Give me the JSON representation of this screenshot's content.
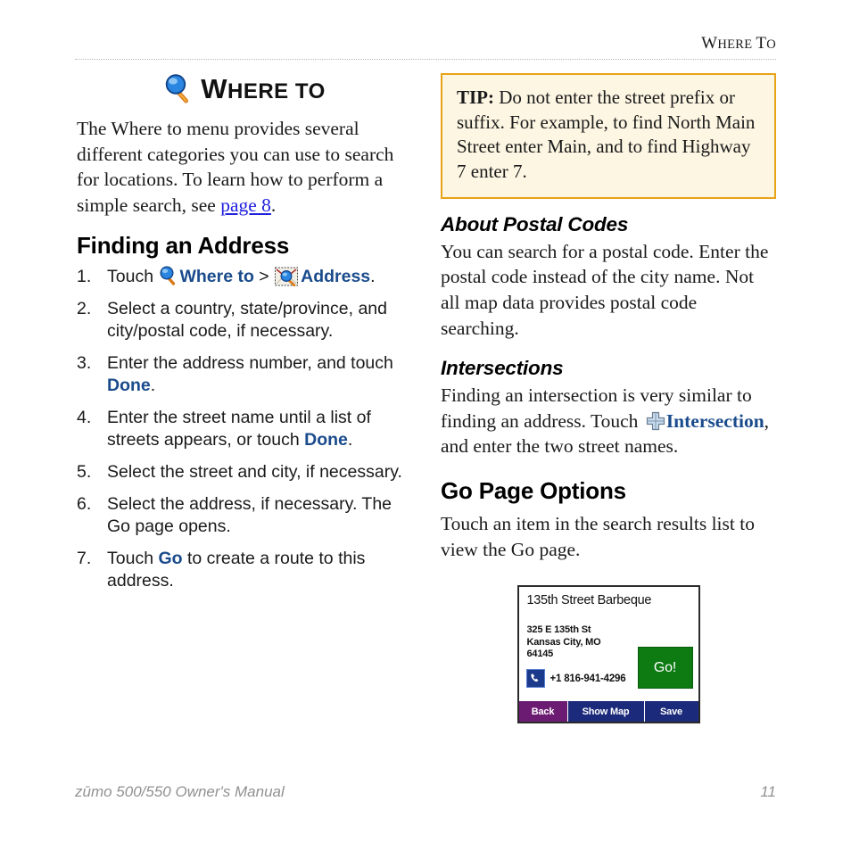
{
  "header": {
    "running_title_lead": "W",
    "running_title_rest_1": "HERE ",
    "running_title_lead_2": "T",
    "running_title_rest_2": "O"
  },
  "chapter": {
    "icon": "magnifying-glass-icon",
    "title_lead": "W",
    "title_rest": "HERE TO"
  },
  "left_column": {
    "intro_part1": "The Where to menu provides several different categories you can use to search for locations. To learn how to perform a simple search, see ",
    "intro_link": "page 8",
    "intro_part2": ".",
    "section_heading": "Finding an Address",
    "steps": [
      {
        "num": "1.",
        "pre": "Touch ",
        "icon1": "magnifying-glass-icon",
        "link1": "Where to",
        "mid": " > ",
        "icon2": "address-search-icon",
        "link2": "Address",
        "post": "."
      },
      {
        "num": "2.",
        "text": "Select a country, state/province, and city/postal code, if necessary."
      },
      {
        "num": "3.",
        "pre": "Enter the address number, and touch ",
        "link1": "Done",
        "post": "."
      },
      {
        "num": "4.",
        "pre": "Enter the street name until a list of streets appears, or touch ",
        "link1": "Done",
        "post": "."
      },
      {
        "num": "5.",
        "text": "Select the street and city, if necessary."
      },
      {
        "num": "6.",
        "text": "Select the address, if necessary. The Go page opens."
      },
      {
        "num": "7.",
        "pre": "Touch ",
        "link1": "Go",
        "post": " to create a route to this address."
      }
    ]
  },
  "right_column": {
    "tip": {
      "label": "TIP:",
      "text": "  Do not enter the street prefix or suffix. For example, to find North Main Street enter Main, and to find Highway 7 enter 7."
    },
    "postal_heading": "About Postal Codes",
    "postal_body": "You can search for a postal code. Enter the postal code instead of the city name. Not all map data provides postal code searching.",
    "intersections_heading": "Intersections",
    "intersections_pre": "Finding an intersection is very similar to finding an address. Touch ",
    "intersections_icon": "intersection-crossroads-icon",
    "intersections_link": "Intersection",
    "intersections_post": ", and enter the two street names.",
    "gopage_heading": "Go Page Options",
    "gopage_body": "Touch an item in the search results list to view the Go page."
  },
  "device_screen": {
    "title": "135th Street Barbeque",
    "address": "325 E 135th St\nKansas City, MO\n64145",
    "phone_icon": "phone-handset-icon",
    "phone": "+1 816-941-4296",
    "go_label": "Go!",
    "buttons": [
      {
        "label": "Back",
        "color": "#6b1b72"
      },
      {
        "label": "Show Map",
        "color": "#1b2a7a"
      },
      {
        "label": "Save",
        "color": "#1b2a7a"
      }
    ]
  },
  "footer": {
    "manual": "zūmo 500/550 Owner's Manual",
    "page_number": "11"
  },
  "colors": {
    "link_blue": "#2020dd",
    "ui_bold_blue": "#1a4b8c",
    "tip_border": "#e8a317",
    "tip_background": "#fdf6e3",
    "footer_gray": "#919191",
    "go_green": "#0d7a12",
    "device_navy": "#1b2a7a",
    "device_purple": "#6b1b72"
  }
}
